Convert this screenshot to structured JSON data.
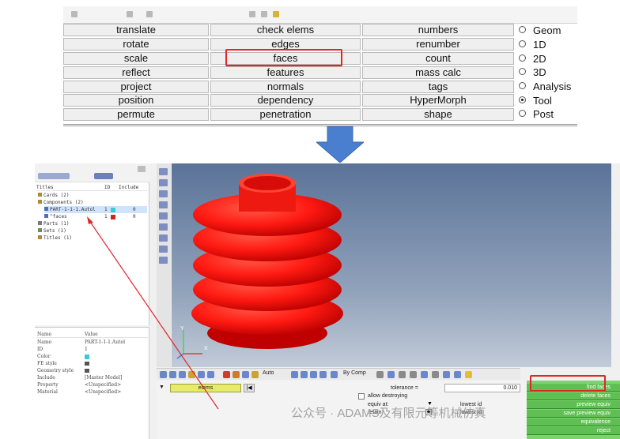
{
  "top_panel": {
    "columns": [
      [
        "translate",
        "rotate",
        "scale",
        "reflect",
        "project",
        "position",
        "permute"
      ],
      [
        "check elems",
        "edges",
        "faces",
        "features",
        "normals",
        "dependency",
        "penetration"
      ],
      [
        "numbers",
        "renumber",
        "count",
        "mass calc",
        "tags",
        "HyperMorph",
        "shape"
      ]
    ],
    "radios": [
      "Geom",
      "1D",
      "2D",
      "3D",
      "Analysis",
      "Tool",
      "Post"
    ],
    "selected_radio": "Tool",
    "highlighted_item": "faces"
  },
  "model_browser": {
    "col_titles": "Titles",
    "col_id": "ID",
    "col_include": "Include",
    "items": [
      {
        "label": "Cards (2)"
      },
      {
        "label": "Components (2)"
      },
      {
        "label": "PART-1-1-1.Autol",
        "id": "1",
        "color": "#3cc8d8",
        "include": "0"
      },
      {
        "label": "^faces",
        "id": "1",
        "color": "#d22222",
        "include": "0"
      },
      {
        "label": "Parts (1)"
      },
      {
        "label": "Sets (1)"
      },
      {
        "label": "Titles (1)"
      }
    ]
  },
  "properties": {
    "header_name": "Name",
    "header_value": "Value",
    "rows": [
      {
        "name": "Name",
        "value": "PART-1-1-1.Autol"
      },
      {
        "name": "ID",
        "value": "1"
      },
      {
        "name": "Color",
        "value": ""
      },
      {
        "name": "FE style",
        "value": ""
      },
      {
        "name": "Geometry style",
        "value": ""
      },
      {
        "name": "Include",
        "value": "[Master Model]"
      },
      {
        "name": "Property",
        "value": "<Unspecified>"
      },
      {
        "name": "Material",
        "value": "<Unspecified>"
      }
    ]
  },
  "viewport": {
    "axis_x": "X",
    "axis_y": "Y",
    "model_color": "#ff1a12",
    "auto_label": "Auto",
    "bycomp_label": "By Comp"
  },
  "faces_form": {
    "entity_selector": "elems",
    "tolerance_label": "tolerance =",
    "tolerance_value": "0.010",
    "allow_destroying": "allow destroying",
    "equiv_at": "equiv at:",
    "equiv_at_value": "lowest id",
    "retain": "retain:",
    "retain_value": "lowest id"
  },
  "commands": [
    "find faces",
    "delete faces",
    "preview equiv",
    "save preview equiv",
    "equivalence",
    "reject"
  ],
  "watermark": "公众号 · ADAMS及有限元等机械仿真"
}
